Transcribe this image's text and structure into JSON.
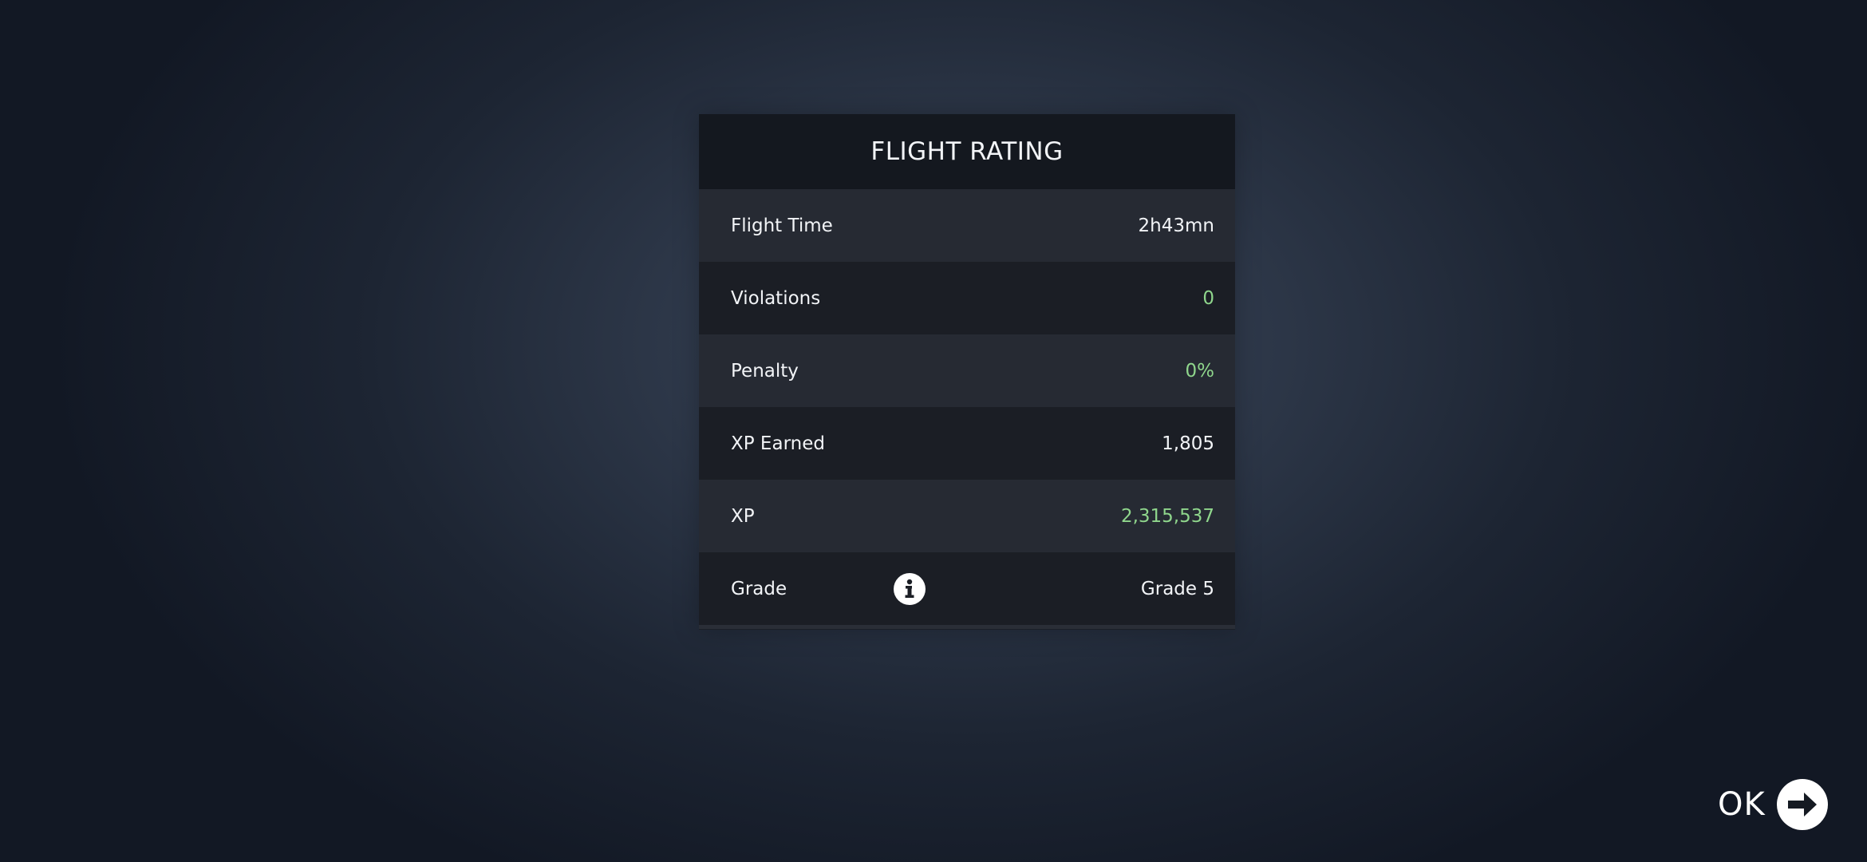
{
  "panel": {
    "title": "FLIGHT RATING",
    "rows": [
      {
        "label": "Flight Time",
        "value": "2h43mn",
        "value_color": "#f2f4f7"
      },
      {
        "label": "Violations",
        "value": "0",
        "value_color": "#8fd68c"
      },
      {
        "label": "Penalty",
        "value": "0%",
        "value_color": "#8fd68c"
      },
      {
        "label": "XP Earned",
        "value": "1,805",
        "value_color": "#f2f4f7"
      },
      {
        "label": "XP",
        "value": "2,315,537",
        "value_color": "#8fd68c"
      },
      {
        "label": "Grade",
        "value": "Grade 5",
        "value_color": "#f2f4f7",
        "icon": "info-icon"
      }
    ]
  },
  "footer": {
    "ok_label": "OK",
    "ok_icon": "arrow-right-circle-icon"
  },
  "colors": {
    "accent_good": "#8fd68c",
    "text": "#f2f4f7"
  }
}
